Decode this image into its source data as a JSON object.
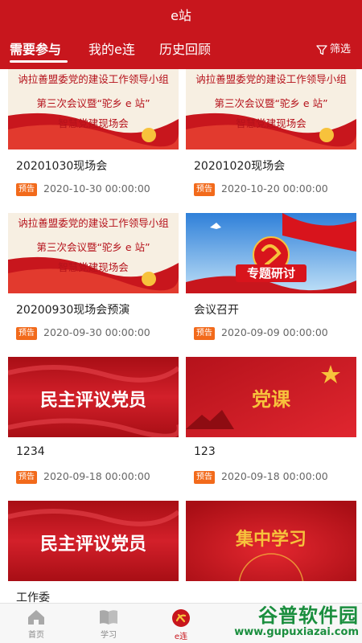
{
  "header": {
    "title": "e站"
  },
  "tabs": [
    {
      "label": "需要参与",
      "active": true
    },
    {
      "label": "我的e连",
      "active": false
    },
    {
      "label": "历史回顾",
      "active": false
    }
  ],
  "filter": {
    "label": "筛选",
    "icon": "filter-icon"
  },
  "cards": [
    {
      "title": "20201030现场会",
      "tag": "预告",
      "date": "2020-10-30 00:00:00",
      "thumb": {
        "kind": "meeting",
        "line1": "讷拉善盟委党的建设工作领导小组",
        "line2": "第三次会议暨“驼乡 e 站”",
        "line3": "智慧党建现场会"
      }
    },
    {
      "title": "20201020现场会",
      "tag": "预告",
      "date": "2020-10-20 00:00:00",
      "thumb": {
        "kind": "meeting",
        "line1": "讷拉善盟委党的建设工作领导小组",
        "line2": "第三次会议暨“驼乡 e 站”",
        "line3": "智慧党建现场会"
      }
    },
    {
      "title": "20200930现场会预演",
      "tag": "预告",
      "date": "2020-09-30 00:00:00",
      "thumb": {
        "kind": "meeting",
        "line1": "讷拉善盟委党的建设工作领导小组",
        "line2": "第三次会议暨“驼乡 e 站”",
        "line3": "智慧党建现场会"
      }
    },
    {
      "title": "会议召开",
      "tag": "预告",
      "date": "2020-09-09 00:00:00",
      "thumb": {
        "kind": "topic",
        "line1": "专题研讨"
      }
    },
    {
      "title": "1234",
      "tag": "预告",
      "date": "2020-09-18 00:00:00",
      "thumb": {
        "kind": "banner",
        "line1": "民主评议党员"
      }
    },
    {
      "title": "123",
      "tag": "预告",
      "date": "2020-09-18 00:00:00",
      "thumb": {
        "kind": "banner-gold",
        "line1": "党课"
      }
    },
    {
      "title": "工作委",
      "tag": "",
      "date": "",
      "thumb": {
        "kind": "banner",
        "line1": "民主评议党员"
      }
    },
    {
      "title": "",
      "tag": "",
      "date": "",
      "thumb": {
        "kind": "banner-gold",
        "line1": "集中学习"
      }
    }
  ],
  "bottom_nav": [
    {
      "label": "首页",
      "icon": "home-icon",
      "active": false
    },
    {
      "label": "学习",
      "icon": "book-icon",
      "active": false
    },
    {
      "label": "e连",
      "icon": "party-emblem-icon",
      "active": true
    }
  ],
  "watermark": {
    "main": "谷普软件园",
    "sub": "www.gupuxiazai.com"
  },
  "colors": {
    "primary": "#c8161d",
    "tag": "#f26a1b",
    "watermark": "#1a8e3e"
  }
}
